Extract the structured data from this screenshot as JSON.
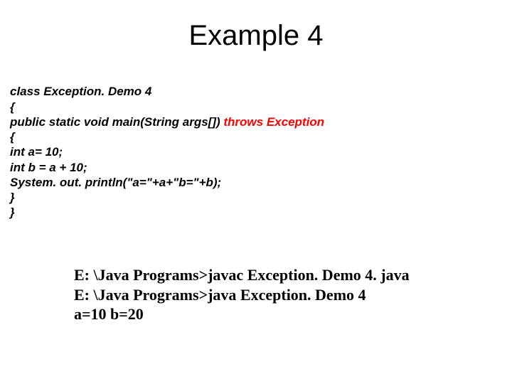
{
  "title": "Example 4",
  "code": {
    "l1": "class Exception. Demo 4",
    "l2": "{",
    "l3a": "public static void main(String args[]) ",
    "l3b": "throws Exception",
    "l4": "{",
    "l5": "int a= 10;",
    "l6": "int b = a + 10;",
    "l7": "System. out. println(\"a=\"+a+\"b=\"+b);",
    "l8": "}",
    "l9": "}"
  },
  "output": {
    "o1": "E: \\Java Programs>javac Exception. Demo 4. java",
    "o2": "E: \\Java Programs>java Exception. Demo 4",
    "o3": "a=10 b=20"
  }
}
